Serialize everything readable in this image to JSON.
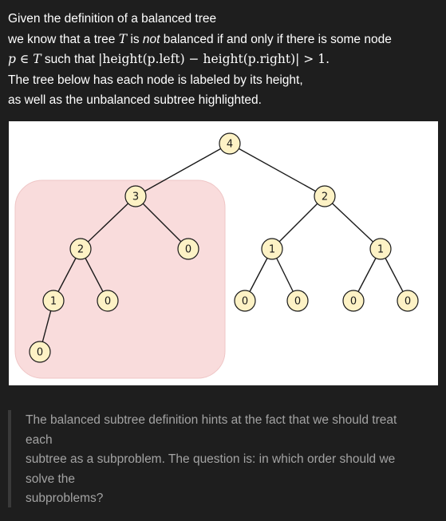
{
  "intro": {
    "line1": "Given the definition of a balanced tree",
    "line2_pre": "we know that a tree ",
    "line2_var": "T",
    "line2_mid": " is ",
    "line2_em": "not",
    "line2_post": " balanced if and only if there is some node",
    "line3_math_pre": "p ∈ T",
    "line3_text": " such that ",
    "line3_formula": "|height(p.left) − height(p.right)| > 1.",
    "line4": "The tree below has each node is labeled by its height,",
    "line5": "as well as the unbalanced subtree highlighted."
  },
  "tree": {
    "highlight_color": "#f9dcdc",
    "node_fill": "#fdf2c5",
    "nodes": [
      {
        "id": "root",
        "label": "4"
      },
      {
        "id": "l",
        "label": "3"
      },
      {
        "id": "r",
        "label": "2"
      },
      {
        "id": "ll",
        "label": "2"
      },
      {
        "id": "lr",
        "label": "0"
      },
      {
        "id": "rl",
        "label": "1"
      },
      {
        "id": "rr",
        "label": "1"
      },
      {
        "id": "lll",
        "label": "1"
      },
      {
        "id": "llr",
        "label": "0"
      },
      {
        "id": "rll",
        "label": "0"
      },
      {
        "id": "rlr",
        "label": "0"
      },
      {
        "id": "rrl",
        "label": "0"
      },
      {
        "id": "rrr",
        "label": "0"
      },
      {
        "id": "llll",
        "label": "0"
      }
    ],
    "edges": [
      [
        "root",
        "l"
      ],
      [
        "root",
        "r"
      ],
      [
        "l",
        "ll"
      ],
      [
        "l",
        "lr"
      ],
      [
        "r",
        "rl"
      ],
      [
        "r",
        "rr"
      ],
      [
        "ll",
        "lll"
      ],
      [
        "ll",
        "llr"
      ],
      [
        "rl",
        "rll"
      ],
      [
        "rl",
        "rlr"
      ],
      [
        "rr",
        "rrl"
      ],
      [
        "rr",
        "rrr"
      ],
      [
        "lll",
        "llll"
      ]
    ]
  },
  "quote": {
    "line1": "The balanced subtree definition hints at the fact that we should treat",
    "line2": "each",
    "line3": "subtree as a subproblem. The question is: in which order should we",
    "line4": "solve the",
    "line5": "subproblems?"
  }
}
